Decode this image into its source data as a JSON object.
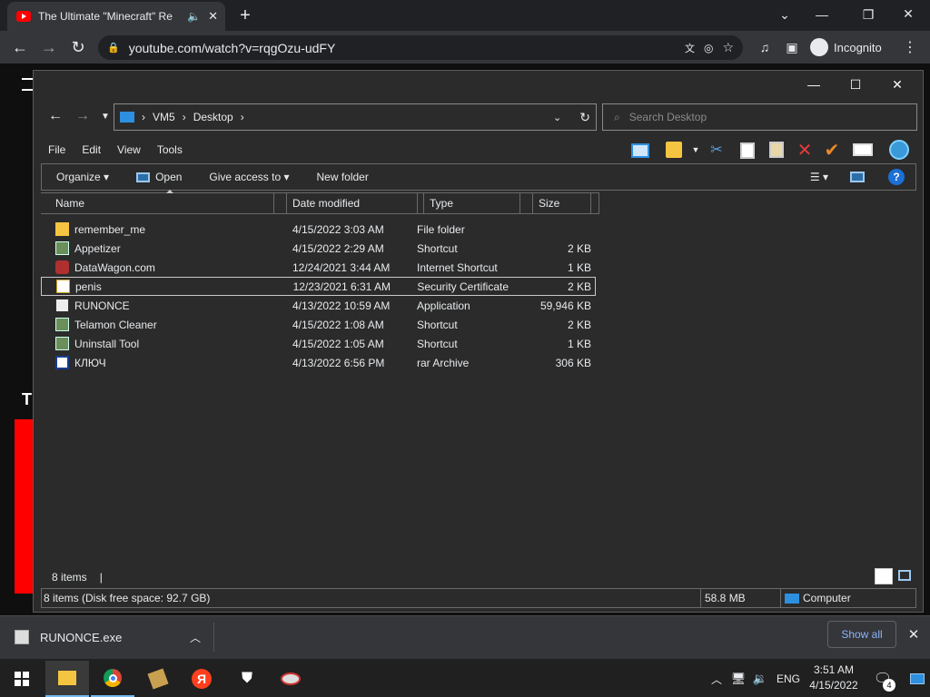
{
  "browser": {
    "tab_title": "The Ultimate \"Minecraft\" Re",
    "url": "youtube.com/watch?v=rqgOzu-udFY",
    "incognito_label": "Incognito",
    "page_letter": "T"
  },
  "explorer": {
    "breadcrumb": [
      "VM5",
      "Desktop"
    ],
    "search_placeholder": "Search Desktop",
    "menu": [
      "File",
      "Edit",
      "View",
      "Tools"
    ],
    "commands": {
      "organize": "Organize",
      "open": "Open",
      "give_access": "Give access to",
      "new_folder": "New folder"
    },
    "columns": {
      "name": "Name",
      "date": "Date modified",
      "type": "Type",
      "size": "Size"
    },
    "files": [
      {
        "name": "remember_me",
        "date": "4/15/2022 3:03 AM",
        "type": "File folder",
        "size": "",
        "icon": "folder-icon"
      },
      {
        "name": "Appetizer",
        "date": "4/15/2022 2:29 AM",
        "type": "Shortcut",
        "size": "2 KB",
        "icon": "shortcut-icon"
      },
      {
        "name": "DataWagon.com",
        "date": "12/24/2021 3:44 AM",
        "type": "Internet Shortcut",
        "size": "1 KB",
        "icon": "internet-shortcut-icon"
      },
      {
        "name": "penis",
        "date": "12/23/2021 6:31 AM",
        "type": "Security Certificate",
        "size": "2 KB",
        "icon": "certificate-icon"
      },
      {
        "name": "RUNONCE",
        "date": "4/13/2022 10:59 AM",
        "type": "Application",
        "size": "59,946 KB",
        "icon": "application-icon"
      },
      {
        "name": "Telamon Cleaner",
        "date": "4/15/2022 1:08 AM",
        "type": "Shortcut",
        "size": "2 KB",
        "icon": "shortcut-icon"
      },
      {
        "name": "Uninstall Tool",
        "date": "4/15/2022 1:05 AM",
        "type": "Shortcut",
        "size": "1 KB",
        "icon": "shortcut-icon"
      },
      {
        "name": "КЛЮЧ",
        "date": "4/13/2022 6:56 PM",
        "type": "rar Archive",
        "size": "306 KB",
        "icon": "archive-icon"
      }
    ],
    "status_count": "8 items",
    "status_detail": "8 items (Disk free space: 92.7 GB)",
    "status_size": "58.8 MB",
    "status_location": "Computer"
  },
  "download": {
    "filename": "RUNONCE.exe",
    "show_all": "Show all"
  },
  "taskbar": {
    "lang": "ENG",
    "time": "3:51 AM",
    "date": "4/15/2022",
    "notif_count": "4",
    "yandex_letter": "Я"
  },
  "colors": {
    "accent": "#8ab4f8",
    "youtube_red": "#ff0000",
    "folder": "#f5c542",
    "delete_red": "#e23b3b",
    "check_orange": "#e8892c"
  }
}
